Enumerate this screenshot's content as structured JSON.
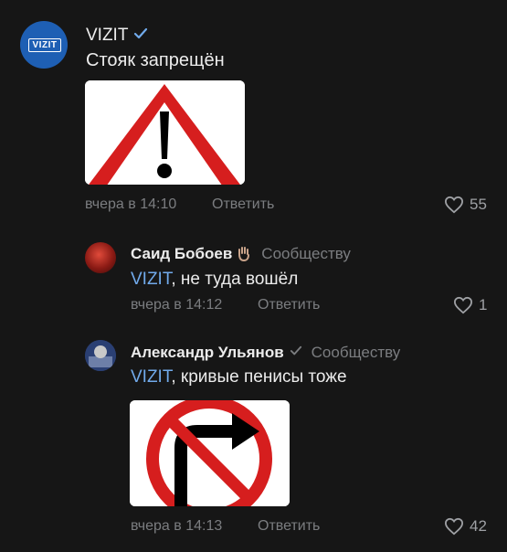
{
  "colors": {
    "background": "#161616",
    "accent": "#71aaeb",
    "vizit_brand": "#1e5fb4"
  },
  "post": {
    "avatar_label": "VIZIT",
    "author": "VIZIT",
    "verified_icon": "checkmark-icon",
    "text": "Стояк запрещён",
    "image_icon": "warning-triangle-sign",
    "time": "вчера в 14:10",
    "reply_label": "Ответить",
    "likes": "55"
  },
  "comments": [
    {
      "author": "Саид Бобоев",
      "author_emoji": "hand-icon",
      "to": "Сообществу",
      "mention": "VIZIT",
      "text": ", не туда вошёл",
      "time": "вчера в 14:12",
      "reply_label": "Ответить",
      "likes": "1"
    },
    {
      "author": "Александр Ульянов",
      "author_badge": "checkmark-icon",
      "to": "Сообществу",
      "mention": "VIZIT",
      "text": ", кривые пенисы тоже",
      "image_icon": "no-right-turn-sign",
      "time": "вчера в 14:13",
      "reply_label": "Ответить",
      "likes": "42"
    }
  ]
}
